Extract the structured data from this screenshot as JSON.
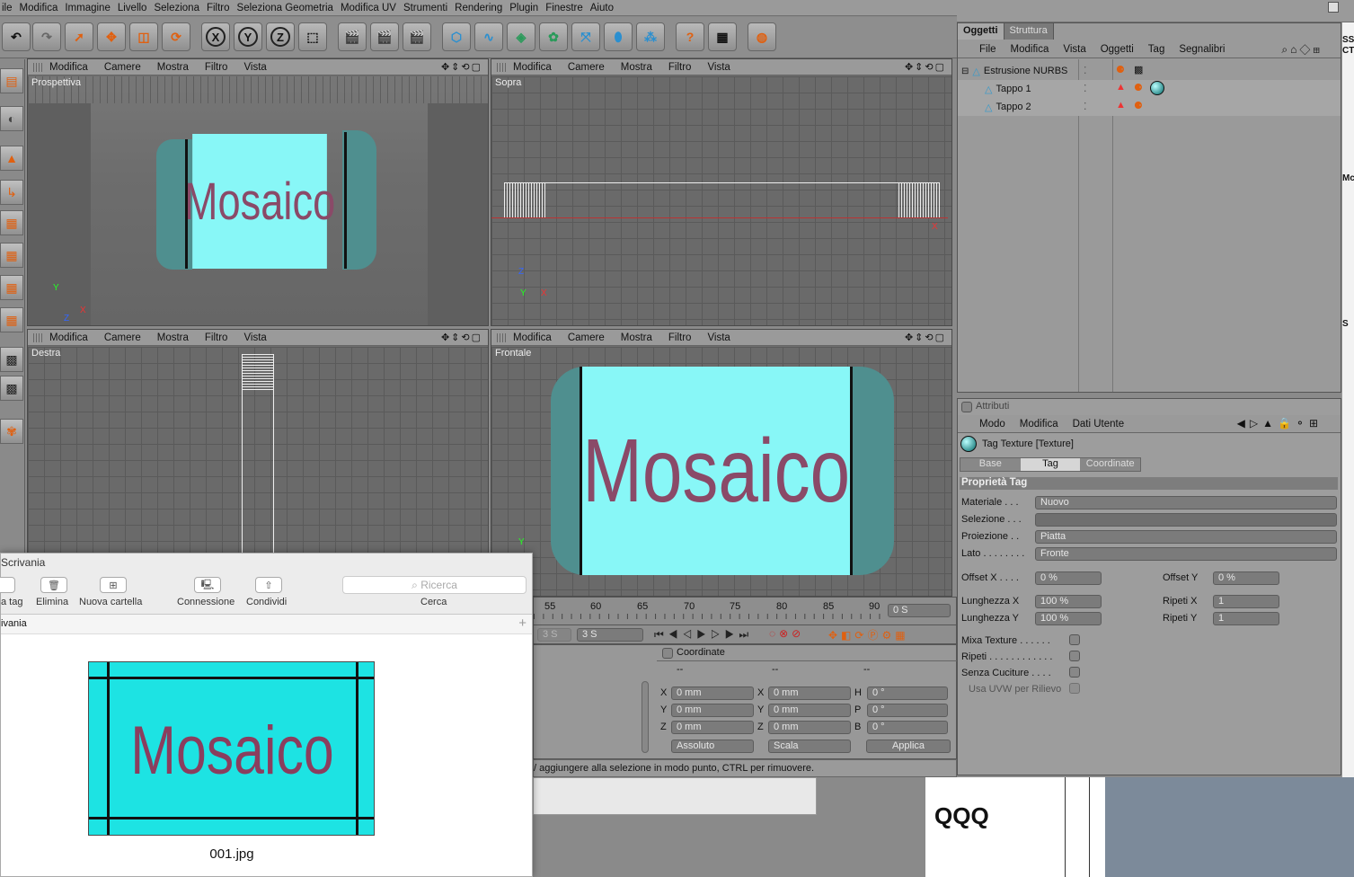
{
  "menubar": [
    "ile",
    "Modifica",
    "Immagine",
    "Livello",
    "Seleziona",
    "Filtro",
    "Seleziona Geometria",
    "Modifica UV",
    "Strumenti",
    "Rendering",
    "Plugin",
    "Finestre",
    "Aiuto"
  ],
  "viewport_menu": [
    "Modifica",
    "Camere",
    "Mostra",
    "Filtro",
    "Vista"
  ],
  "viewports": {
    "perspective": "Prospettiva",
    "top": "Sopra",
    "right": "Destra",
    "front": "Frontale"
  },
  "mosaic_text": "Mosaico",
  "object_manager": {
    "tabs": [
      "Oggetti",
      "Struttura"
    ],
    "menu": [
      "File",
      "Modifica",
      "Vista",
      "Oggetti",
      "Tag",
      "Segnalibri"
    ],
    "objects": [
      "Estrusione NURBS",
      "Tappo 1",
      "Tappo 2"
    ]
  },
  "attributes": {
    "title": "Attributi",
    "menu": [
      "Modo",
      "Modifica",
      "Dati Utente"
    ],
    "tag_title": "Tag Texture [Texture]",
    "tabs": [
      "Base",
      "Tag",
      "Coordinate"
    ],
    "section": "Proprietà Tag",
    "materiale_label": "Materiale . . .",
    "materiale_value": "Nuovo",
    "selezione_label": "Selezione . . .",
    "proiezione_label": "Proiezione . .",
    "proiezione_value": "Piatta",
    "lato_label": "Lato . . . . . . . .",
    "lato_value": "Fronte",
    "offset_x_label": "Offset X . . . .",
    "offset_x_value": "0 %",
    "offset_y_label": "Offset Y",
    "offset_y_value": "0 %",
    "lunghezza_x_label": "Lunghezza X",
    "lunghezza_x_value": "100 %",
    "lunghezza_y_label": "Lunghezza Y",
    "lunghezza_y_value": "100 %",
    "ripeti_x_label": "Ripeti X",
    "ripeti_x_value": "1",
    "ripeti_y_label": "Ripeti Y",
    "ripeti_y_value": "1",
    "mixa_label": "Mixa Texture . . . . . .",
    "ripeti_label": "Ripeti . . . . . . . . . . . .",
    "senza_label": "Senza Cuciture . . . .",
    "uvw_label": "Usa UVW per Rilievo"
  },
  "timeline": {
    "ticks": [
      "55",
      "60",
      "65",
      "70",
      "75",
      "80",
      "85",
      "90"
    ],
    "current": "0 S",
    "field": "3 S",
    "field_faded": "3 S"
  },
  "coordinates": {
    "title": "Coordinate",
    "dashes": [
      "--",
      "--",
      "--"
    ],
    "rows": [
      {
        "a": "X",
        "av": "0 mm",
        "b": "X",
        "bv": "0 mm",
        "c": "H",
        "cv": "0 °"
      },
      {
        "a": "Y",
        "av": "0 mm",
        "b": "Y",
        "bv": "0 mm",
        "c": "P",
        "cv": "0 °"
      },
      {
        "a": "Z",
        "av": "0 mm",
        "b": "Z",
        "bv": "0 mm",
        "c": "B",
        "cv": "0 °"
      }
    ],
    "mode": "Assoluto",
    "scale": "Scala",
    "apply": "Applica"
  },
  "status_text": "/ aggiungere alla selezione in modo punto, CTRL per rimuovere.",
  "finder": {
    "title": "Scrivania",
    "path": "ivania",
    "buttons": [
      "a tag",
      "Elimina",
      "Nuova cartella",
      "Connessione",
      "Condividi"
    ],
    "search_placeholder": "Ricerca",
    "search_label": "Cerca",
    "file_name": "001.jpg"
  },
  "background_text": "QQQ",
  "edge_text": [
    "SS",
    "CT",
    "Mc",
    "S"
  ]
}
